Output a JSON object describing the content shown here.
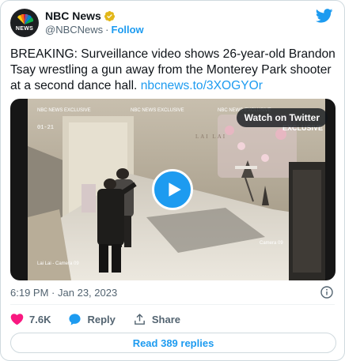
{
  "author": {
    "name": "NBC News",
    "avatar_label": "NEWS",
    "handle": "@NBCNews",
    "separator": "·",
    "follow_label": "Follow"
  },
  "tweet": {
    "text": "BREAKING: Surveillance video shows 26-year-old Brandon Tsay wrestling a gun away from the Monterey Park shooter at a second dance hall. ",
    "link": "nbcnews.to/3XOGYOr"
  },
  "media": {
    "watch_label": "Watch on Twitter",
    "overlay_top_left": "NBC NEWS EXCLUSIVE",
    "overlay_top_center": "NBC NEWS EXCLUSIVE",
    "overlay_top_right": "NBC NEWS EXCLUSIVE",
    "overlay_timestamp": "01-21",
    "overlay_exclusive": "EXCLUSIVE",
    "overlay_sign": "LAI LAI",
    "overlay_camera_right": "Camera 09",
    "overlay_camera_bottom": "Lai Lai - Camera 09"
  },
  "meta": {
    "time": "6:19 PM",
    "dot": "·",
    "date": "Jan 23, 2023"
  },
  "actions": {
    "likes": "7.6K",
    "reply_label": "Reply",
    "share_label": "Share"
  },
  "replies_button": "Read 389 replies",
  "colors": {
    "accent": "#1d9bf0",
    "like": "#f91880",
    "verified": "#e2b719",
    "muted": "#536471"
  }
}
